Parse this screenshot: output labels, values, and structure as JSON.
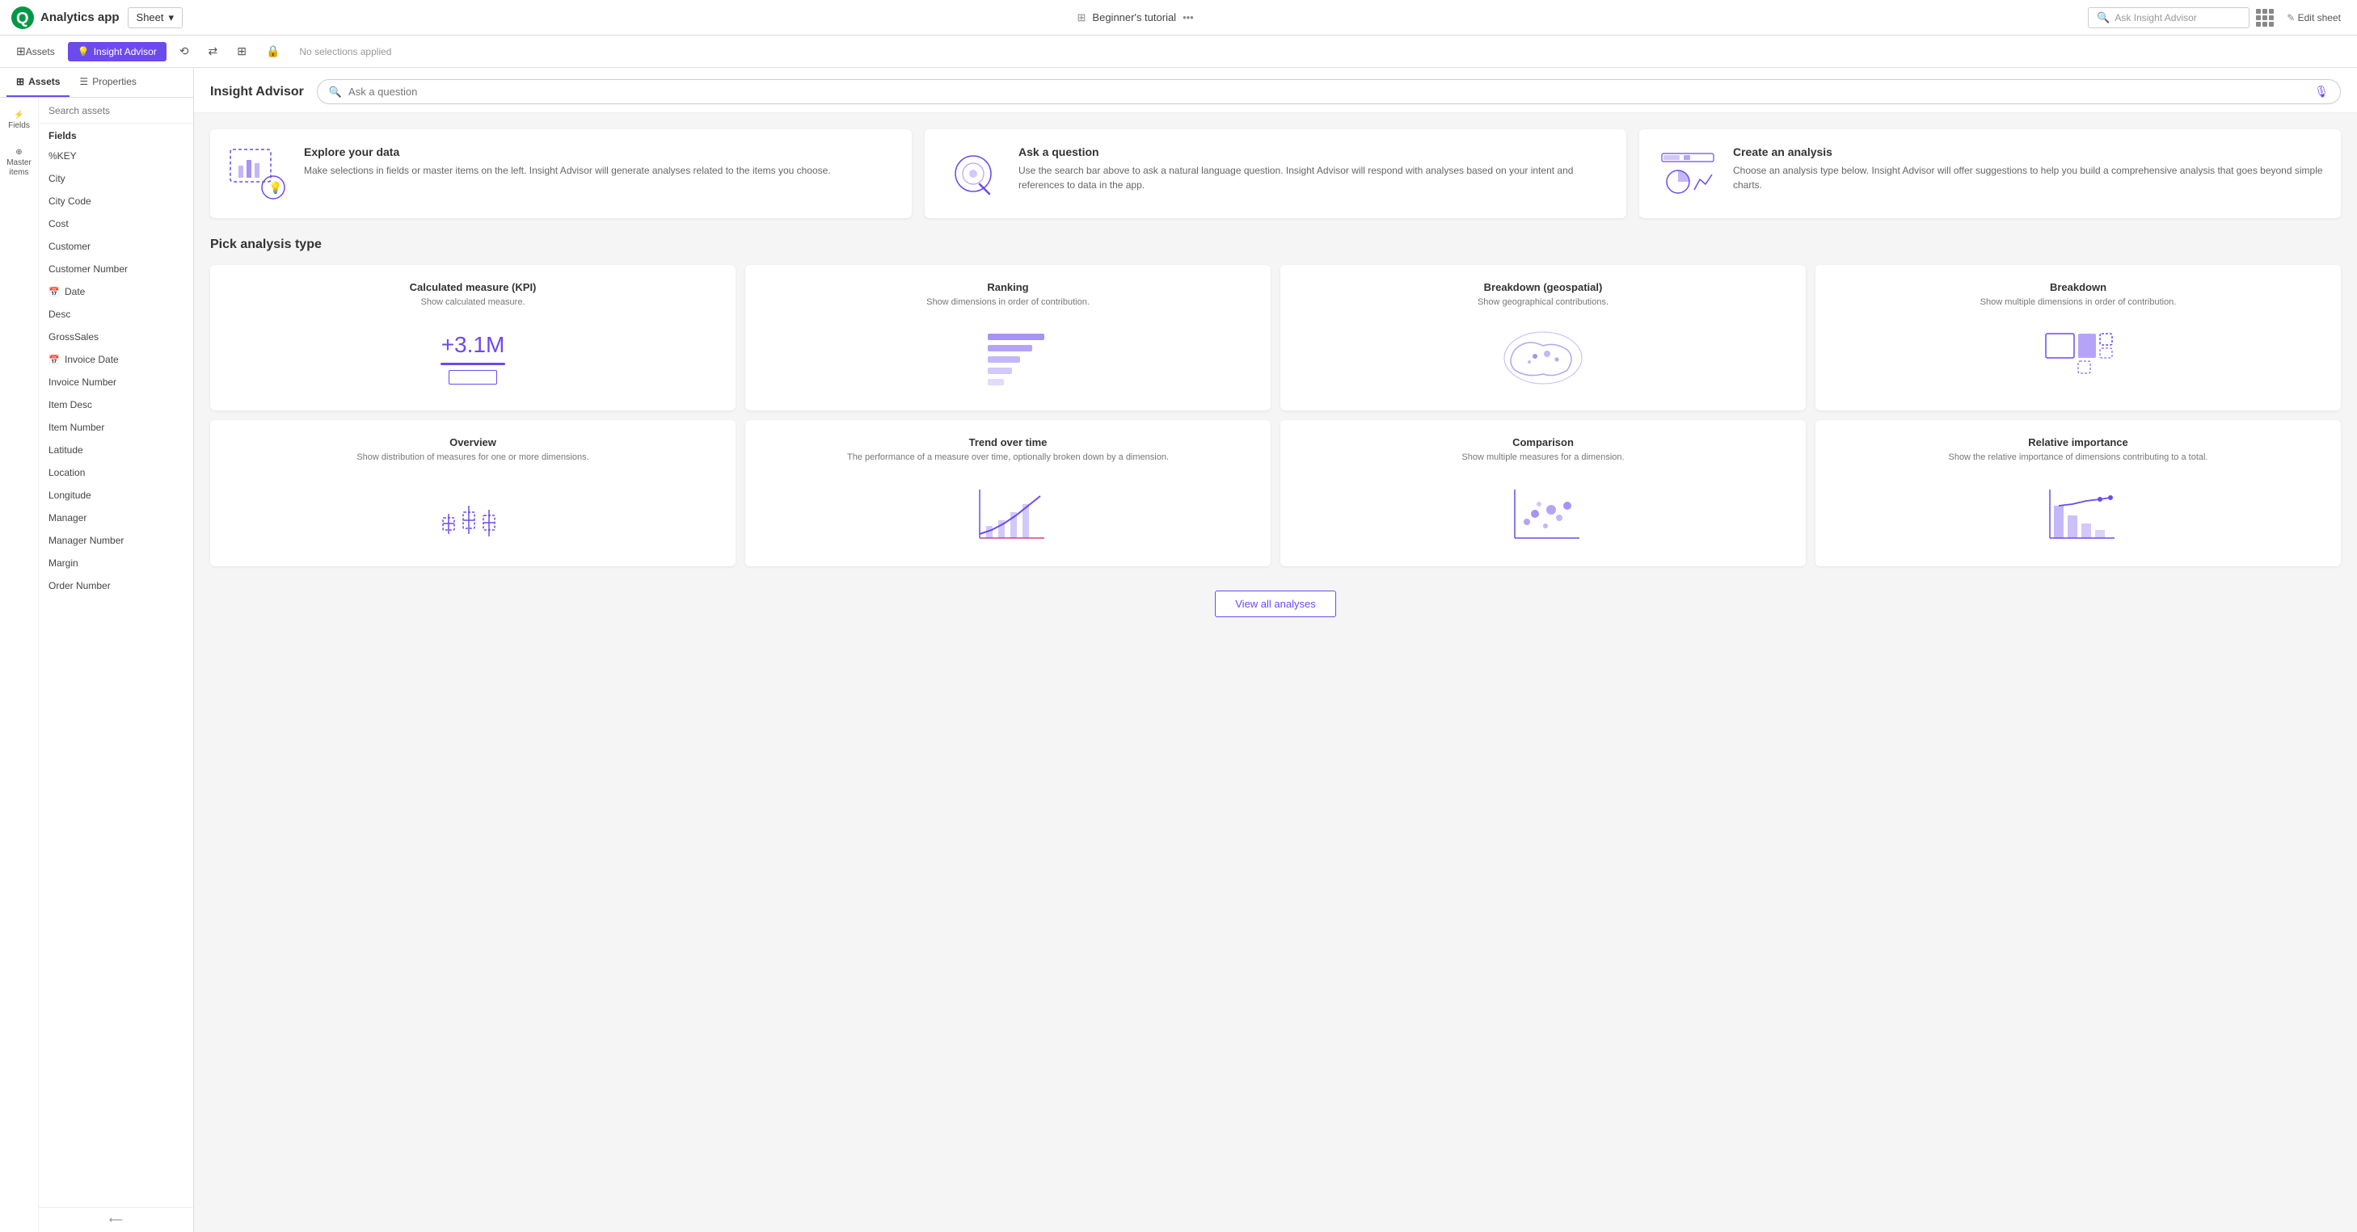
{
  "app": {
    "logo_text": "Qlik",
    "sub_title": "Analytics app",
    "dropdown_label": "Sheet",
    "nav_title": "Beginner's tutorial",
    "search_placeholder": "Ask Insight Advisor",
    "edit_sheet": "Edit sheet"
  },
  "toolbar": {
    "insight_advisor_label": "Insight Advisor",
    "no_selections": "No selections applied",
    "assets_label": "Assets"
  },
  "left_panel": {
    "tabs": [
      {
        "id": "assets",
        "label": "Assets",
        "active": true
      },
      {
        "id": "properties",
        "label": "Properties",
        "active": false
      }
    ],
    "sidebar_icons": [
      {
        "id": "fields",
        "label": "Fields",
        "active": true
      },
      {
        "id": "master-items",
        "label": "Master items",
        "active": false
      }
    ],
    "search_placeholder": "Search assets",
    "fields_label": "Fields",
    "fields": [
      {
        "id": "key",
        "label": "%KEY",
        "type": "text"
      },
      {
        "id": "city",
        "label": "City",
        "type": "text"
      },
      {
        "id": "city-code",
        "label": "City Code",
        "type": "text"
      },
      {
        "id": "cost",
        "label": "Cost",
        "type": "text"
      },
      {
        "id": "customer",
        "label": "Customer",
        "type": "text"
      },
      {
        "id": "customer-number",
        "label": "Customer Number",
        "type": "text"
      },
      {
        "id": "date",
        "label": "Date",
        "type": "date"
      },
      {
        "id": "desc",
        "label": "Desc",
        "type": "text"
      },
      {
        "id": "gross-sales",
        "label": "GrossSales",
        "type": "text"
      },
      {
        "id": "invoice-date",
        "label": "Invoice Date",
        "type": "date"
      },
      {
        "id": "invoice-number",
        "label": "Invoice Number",
        "type": "text"
      },
      {
        "id": "item-desc",
        "label": "Item Desc",
        "type": "text"
      },
      {
        "id": "item-number",
        "label": "Item Number",
        "type": "text"
      },
      {
        "id": "latitude",
        "label": "Latitude",
        "type": "text"
      },
      {
        "id": "location",
        "label": "Location",
        "type": "text"
      },
      {
        "id": "longitude",
        "label": "Longitude",
        "type": "text"
      },
      {
        "id": "manager",
        "label": "Manager",
        "type": "text"
      },
      {
        "id": "manager-number",
        "label": "Manager Number",
        "type": "text"
      },
      {
        "id": "margin",
        "label": "Margin",
        "type": "text"
      },
      {
        "id": "order-number",
        "label": "Order Number",
        "type": "text"
      }
    ]
  },
  "content": {
    "header_title": "Insight Advisor",
    "ask_placeholder": "Ask a question",
    "info_cards": [
      {
        "id": "explore",
        "title": "Explore your data",
        "description": "Make selections in fields or master items on the left. Insight Advisor will generate analyses related to the items you choose."
      },
      {
        "id": "ask",
        "title": "Ask a question",
        "description": "Use the search bar above to ask a natural language question. Insight Advisor will respond with analyses based on your intent and references to data in the app."
      },
      {
        "id": "create",
        "title": "Create an analysis",
        "description": "Choose an analysis type below. Insight Advisor will offer suggestions to help you build a comprehensive analysis that goes beyond simple charts."
      }
    ],
    "pick_analysis_title": "Pick analysis type",
    "analysis_types": [
      {
        "id": "kpi",
        "title": "Calculated measure (KPI)",
        "description": "Show calculated measure.",
        "visual": "kpi"
      },
      {
        "id": "ranking",
        "title": "Ranking",
        "description": "Show dimensions in order of contribution.",
        "visual": "ranking"
      },
      {
        "id": "breakdown-geo",
        "title": "Breakdown (geospatial)",
        "description": "Show geographical contributions.",
        "visual": "geo"
      },
      {
        "id": "breakdown",
        "title": "Breakdown",
        "description": "Show multiple dimensions in order of contribution.",
        "visual": "breakdown"
      },
      {
        "id": "overview",
        "title": "Overview",
        "description": "Show distribution of measures for one or more dimensions.",
        "visual": "overview"
      },
      {
        "id": "trend",
        "title": "Trend over time",
        "description": "The performance of a measure over time, optionally broken down by a dimension.",
        "visual": "trend"
      },
      {
        "id": "comparison",
        "title": "Comparison",
        "description": "Show multiple measures for a dimension.",
        "visual": "comparison"
      },
      {
        "id": "relative",
        "title": "Relative importance",
        "description": "Show the relative importance of dimensions contributing to a total.",
        "visual": "relative"
      }
    ],
    "view_all_label": "View all analyses",
    "kpi_value": "+3.1M"
  },
  "colors": {
    "accent": "#6c4aee",
    "accent_light": "#f0eeff",
    "border": "#ddd",
    "text_primary": "#333",
    "text_secondary": "#666",
    "text_muted": "#999"
  }
}
